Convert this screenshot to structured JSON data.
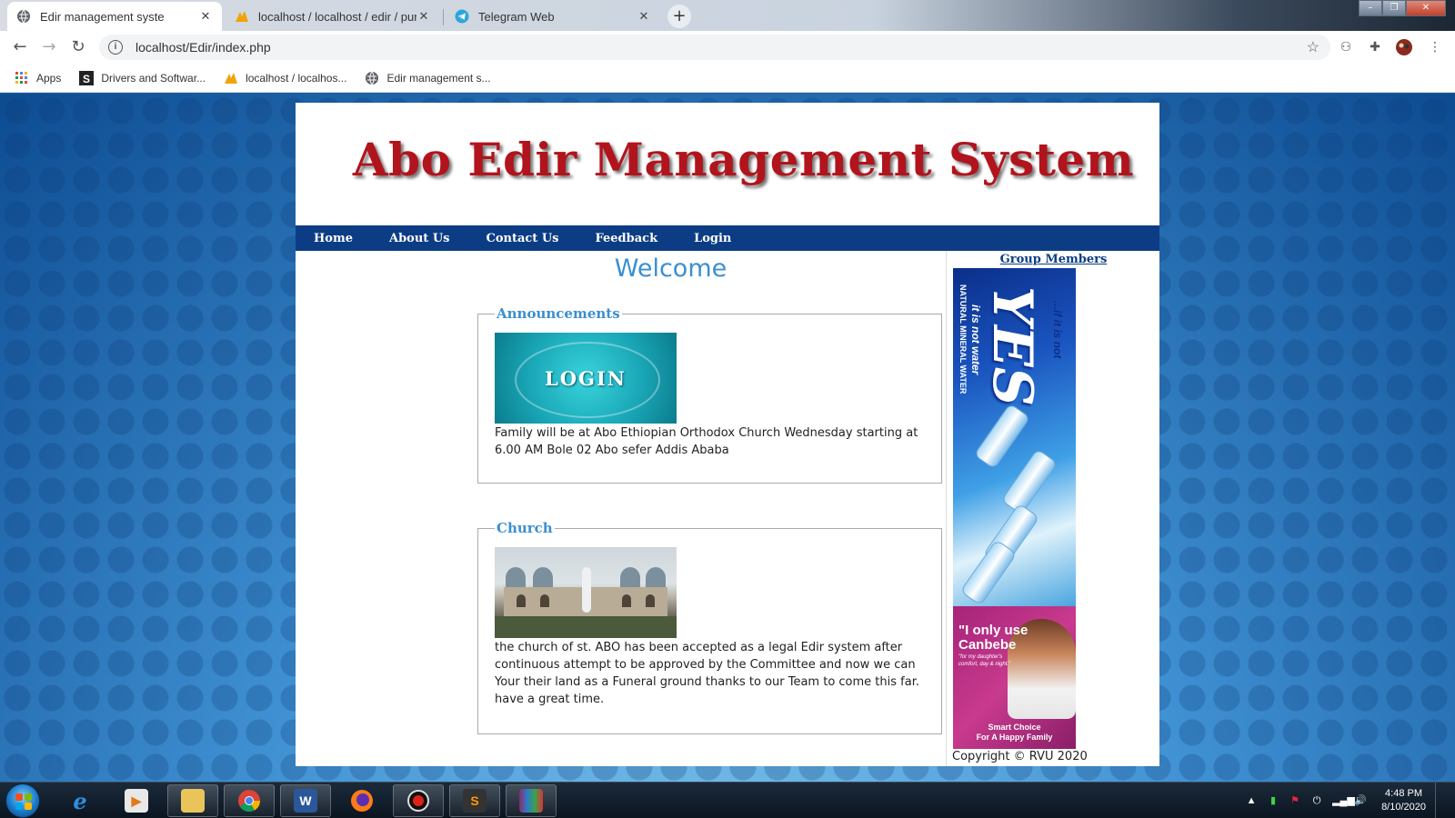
{
  "browser": {
    "tabs": [
      {
        "title": "Edir management syste",
        "favicon": "globe-icon",
        "active": true
      },
      {
        "title": "localhost / localhost / edir / puni",
        "favicon": "phpmyadmin-icon",
        "active": false
      },
      {
        "title": "Telegram Web",
        "favicon": "telegram-icon",
        "active": false
      }
    ],
    "address": "localhost/Edir/index.php",
    "bookmarks": [
      {
        "label": "Apps",
        "icon": "apps-grid-icon"
      },
      {
        "label": "Drivers and Softwar...",
        "icon": "s-logo-icon"
      },
      {
        "label": "localhost / localhos...",
        "icon": "phpmyadmin-icon"
      },
      {
        "label": "Edir management s...",
        "icon": "globe-icon"
      }
    ]
  },
  "site": {
    "banner_title": "Abo Edir Management System",
    "menu": [
      "Home",
      "About Us",
      "Contact Us",
      "Feedback",
      "Login"
    ],
    "welcome": "Welcome",
    "announcements": {
      "legend": "Announcements",
      "image_text": "LOGIN",
      "text": "Family will be at Abo Ethiopian Orthodox Church Wednesday starting at 6.00 AM Bole 02 Abo sefer Addis Ababa"
    },
    "church": {
      "legend": "Church",
      "text": "the church of st. ABO has been accepted as a legal Edir system after continuous attempt to be approved by the Committee and now we can Your their land as a Funeral ground thanks to our Team to come this far. have a great time."
    },
    "sidebar": {
      "group_members": "Group Members",
      "ad_water": {
        "brand": "YES",
        "tagline": "...if it is not",
        "sub1": "NATURAL MINERAL WATER",
        "sub2": "it is not water"
      },
      "ad_diaper": {
        "line1": "\"I only use",
        "line2": "Canbebe",
        "line3": "\"for my daughter's comfort, day & night.\"",
        "line4": "Smart Choice",
        "line5": "For A Happy Family"
      }
    },
    "copyright": "Copyright © RVU 2020"
  },
  "taskbar": {
    "apps": [
      "internet-explorer-icon",
      "media-player-icon",
      "file-explorer-icon",
      "chrome-icon",
      "word-icon",
      "firefox-icon",
      "recorder-icon",
      "sublime-icon",
      "winrar-icon"
    ],
    "time": "4:48 PM",
    "date": "8/10/2020"
  },
  "colors": {
    "brand_red": "#b1141c",
    "menu_blue": "#0c3d84",
    "accent_blue": "#3b8fd0"
  }
}
